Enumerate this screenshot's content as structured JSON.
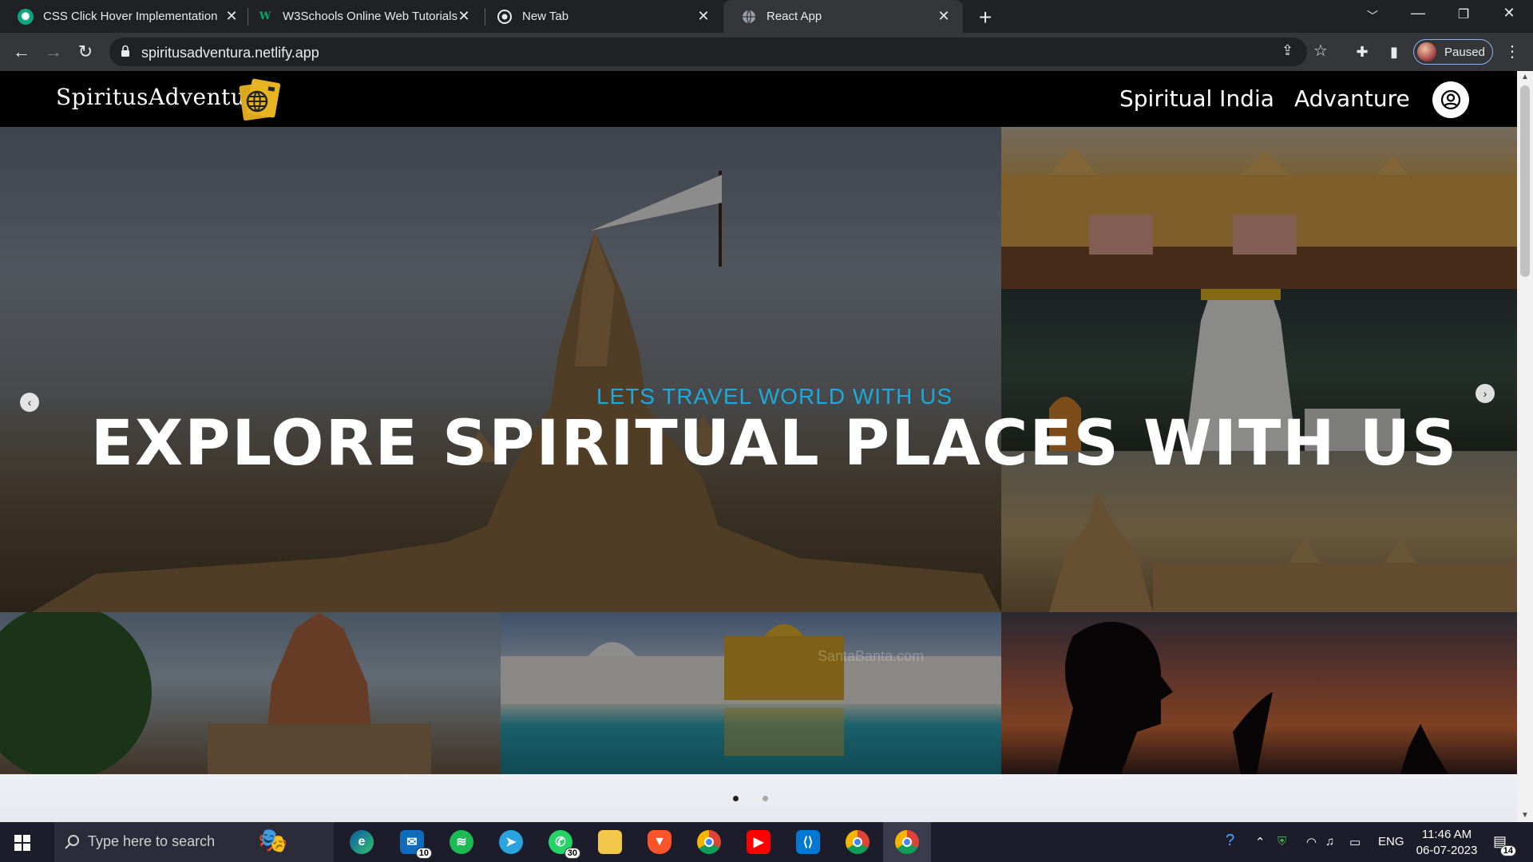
{
  "browser": {
    "tabs": [
      {
        "title": "CSS Click Hover Implementation",
        "icon": "chatgpt-icon",
        "active": false
      },
      {
        "title": "W3Schools Online Web Tutorials",
        "icon": "w3schools-icon",
        "active": false
      },
      {
        "title": "New Tab",
        "icon": "chrome-icon",
        "active": false
      },
      {
        "title": "React App",
        "icon": "globe-icon",
        "active": true
      }
    ],
    "url": "spiritusadventura.netlify.app",
    "profile_label": "Paused"
  },
  "site": {
    "logo": "SpiritusAdventura",
    "nav": [
      "Spiritual India",
      "Advanture"
    ],
    "hero_subtitle": "LETS TRAVEL WORLD WITH US",
    "hero_title": "EXPLORE SPIRITUAL PLACES WITH US",
    "watermark": "SantaBanta.com",
    "slides": {
      "count": 2,
      "active": 0
    }
  },
  "taskbar": {
    "search_placeholder": "Type here to search",
    "mail_badge": "10",
    "whatsapp_badge": "30",
    "language": "ENG",
    "time": "11:46 AM",
    "date": "06-07-2023",
    "notifications": "14"
  },
  "colors": {
    "accent": "#1fa8d8",
    "chrome_bg": "#202124",
    "toolbar_bg": "#35363a",
    "logo_gold": "#e6b422"
  }
}
